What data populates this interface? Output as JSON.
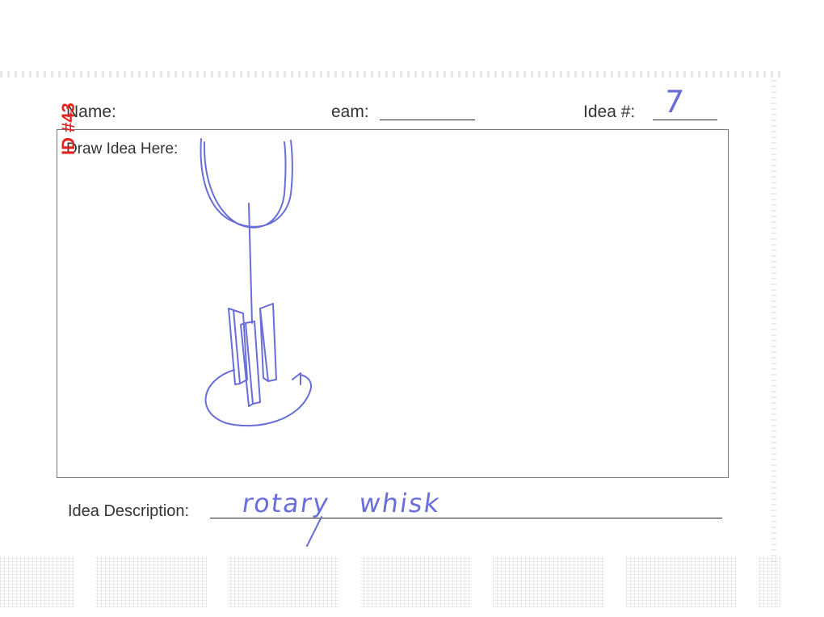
{
  "form": {
    "name_label": "Name:",
    "team_label": "eam:",
    "idea_number_label": "Idea #:",
    "idea_number_value": "7",
    "draw_label": "Draw Idea Here:",
    "description_label": "Idea Description:",
    "description_value": "rotary   whisk"
  },
  "stamp": {
    "id_text": "ID #43"
  },
  "colors": {
    "ink": "#6a6ed8",
    "stamp": "#e8221c",
    "print": "#333333"
  }
}
